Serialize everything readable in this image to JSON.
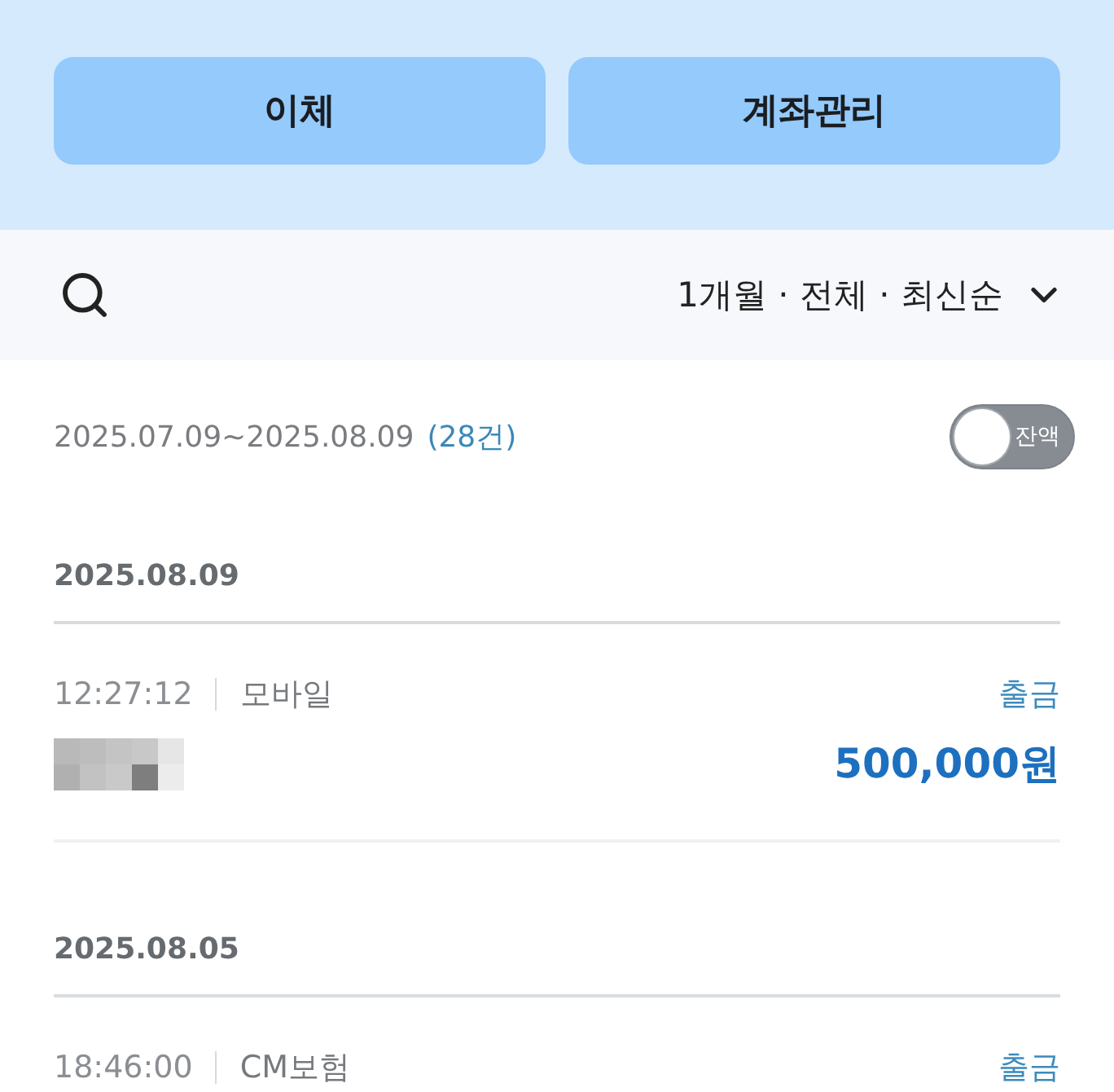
{
  "actions": [
    {
      "label": "이체"
    },
    {
      "label": "계좌관리"
    }
  ],
  "filter_bar": {
    "summary": "1개월 · 전체 · 최신순"
  },
  "period": {
    "range": "2025.07.09~2025.08.09",
    "count": "(28건)"
  },
  "balance_toggle": {
    "label": "잔액",
    "on": false
  },
  "groups": [
    {
      "date": "2025.08.09",
      "transactions": [
        {
          "time": "12:27:12",
          "channel": "모바일",
          "type": "출금",
          "redacted": true,
          "amount": "500,000원"
        }
      ]
    },
    {
      "date": "2025.08.05",
      "transactions": [
        {
          "time": "18:46:00",
          "channel": "CM보험",
          "type": "출금"
        }
      ]
    }
  ]
}
